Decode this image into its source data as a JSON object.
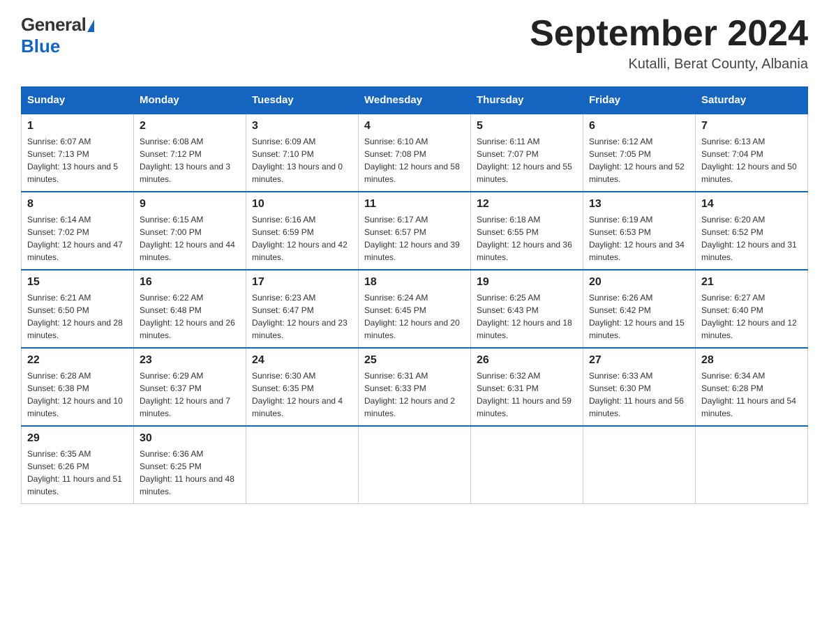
{
  "header": {
    "logo_general": "General",
    "logo_blue": "Blue",
    "month_title": "September 2024",
    "location": "Kutalli, Berat County, Albania"
  },
  "days_of_week": [
    "Sunday",
    "Monday",
    "Tuesday",
    "Wednesday",
    "Thursday",
    "Friday",
    "Saturday"
  ],
  "weeks": [
    [
      {
        "day": "1",
        "sunrise": "6:07 AM",
        "sunset": "7:13 PM",
        "daylight": "13 hours and 5 minutes."
      },
      {
        "day": "2",
        "sunrise": "6:08 AM",
        "sunset": "7:12 PM",
        "daylight": "13 hours and 3 minutes."
      },
      {
        "day": "3",
        "sunrise": "6:09 AM",
        "sunset": "7:10 PM",
        "daylight": "13 hours and 0 minutes."
      },
      {
        "day": "4",
        "sunrise": "6:10 AM",
        "sunset": "7:08 PM",
        "daylight": "12 hours and 58 minutes."
      },
      {
        "day": "5",
        "sunrise": "6:11 AM",
        "sunset": "7:07 PM",
        "daylight": "12 hours and 55 minutes."
      },
      {
        "day": "6",
        "sunrise": "6:12 AM",
        "sunset": "7:05 PM",
        "daylight": "12 hours and 52 minutes."
      },
      {
        "day": "7",
        "sunrise": "6:13 AM",
        "sunset": "7:04 PM",
        "daylight": "12 hours and 50 minutes."
      }
    ],
    [
      {
        "day": "8",
        "sunrise": "6:14 AM",
        "sunset": "7:02 PM",
        "daylight": "12 hours and 47 minutes."
      },
      {
        "day": "9",
        "sunrise": "6:15 AM",
        "sunset": "7:00 PM",
        "daylight": "12 hours and 44 minutes."
      },
      {
        "day": "10",
        "sunrise": "6:16 AM",
        "sunset": "6:59 PM",
        "daylight": "12 hours and 42 minutes."
      },
      {
        "day": "11",
        "sunrise": "6:17 AM",
        "sunset": "6:57 PM",
        "daylight": "12 hours and 39 minutes."
      },
      {
        "day": "12",
        "sunrise": "6:18 AM",
        "sunset": "6:55 PM",
        "daylight": "12 hours and 36 minutes."
      },
      {
        "day": "13",
        "sunrise": "6:19 AM",
        "sunset": "6:53 PM",
        "daylight": "12 hours and 34 minutes."
      },
      {
        "day": "14",
        "sunrise": "6:20 AM",
        "sunset": "6:52 PM",
        "daylight": "12 hours and 31 minutes."
      }
    ],
    [
      {
        "day": "15",
        "sunrise": "6:21 AM",
        "sunset": "6:50 PM",
        "daylight": "12 hours and 28 minutes."
      },
      {
        "day": "16",
        "sunrise": "6:22 AM",
        "sunset": "6:48 PM",
        "daylight": "12 hours and 26 minutes."
      },
      {
        "day": "17",
        "sunrise": "6:23 AM",
        "sunset": "6:47 PM",
        "daylight": "12 hours and 23 minutes."
      },
      {
        "day": "18",
        "sunrise": "6:24 AM",
        "sunset": "6:45 PM",
        "daylight": "12 hours and 20 minutes."
      },
      {
        "day": "19",
        "sunrise": "6:25 AM",
        "sunset": "6:43 PM",
        "daylight": "12 hours and 18 minutes."
      },
      {
        "day": "20",
        "sunrise": "6:26 AM",
        "sunset": "6:42 PM",
        "daylight": "12 hours and 15 minutes."
      },
      {
        "day": "21",
        "sunrise": "6:27 AM",
        "sunset": "6:40 PM",
        "daylight": "12 hours and 12 minutes."
      }
    ],
    [
      {
        "day": "22",
        "sunrise": "6:28 AM",
        "sunset": "6:38 PM",
        "daylight": "12 hours and 10 minutes."
      },
      {
        "day": "23",
        "sunrise": "6:29 AM",
        "sunset": "6:37 PM",
        "daylight": "12 hours and 7 minutes."
      },
      {
        "day": "24",
        "sunrise": "6:30 AM",
        "sunset": "6:35 PM",
        "daylight": "12 hours and 4 minutes."
      },
      {
        "day": "25",
        "sunrise": "6:31 AM",
        "sunset": "6:33 PM",
        "daylight": "12 hours and 2 minutes."
      },
      {
        "day": "26",
        "sunrise": "6:32 AM",
        "sunset": "6:31 PM",
        "daylight": "11 hours and 59 minutes."
      },
      {
        "day": "27",
        "sunrise": "6:33 AM",
        "sunset": "6:30 PM",
        "daylight": "11 hours and 56 minutes."
      },
      {
        "day": "28",
        "sunrise": "6:34 AM",
        "sunset": "6:28 PM",
        "daylight": "11 hours and 54 minutes."
      }
    ],
    [
      {
        "day": "29",
        "sunrise": "6:35 AM",
        "sunset": "6:26 PM",
        "daylight": "11 hours and 51 minutes."
      },
      {
        "day": "30",
        "sunrise": "6:36 AM",
        "sunset": "6:25 PM",
        "daylight": "11 hours and 48 minutes."
      },
      {
        "day": "",
        "sunrise": "",
        "sunset": "",
        "daylight": ""
      },
      {
        "day": "",
        "sunrise": "",
        "sunset": "",
        "daylight": ""
      },
      {
        "day": "",
        "sunrise": "",
        "sunset": "",
        "daylight": ""
      },
      {
        "day": "",
        "sunrise": "",
        "sunset": "",
        "daylight": ""
      },
      {
        "day": "",
        "sunrise": "",
        "sunset": "",
        "daylight": ""
      }
    ]
  ],
  "labels": {
    "sunrise": "Sunrise:",
    "sunset": "Sunset:",
    "daylight": "Daylight:"
  }
}
